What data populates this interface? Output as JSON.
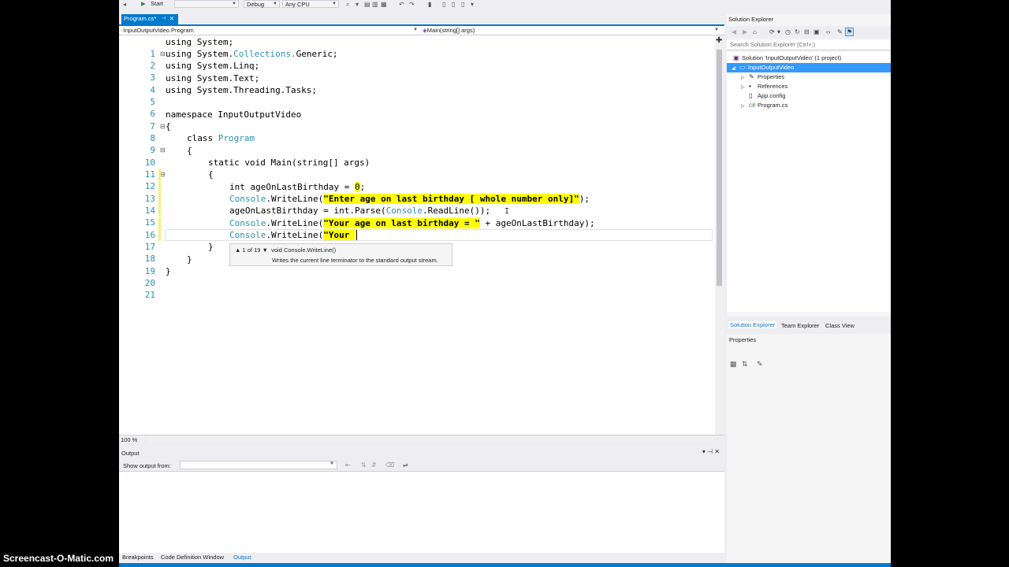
{
  "toolbar": {
    "start_label": "Start",
    "config_value": "Debug",
    "platform_value": "Any CPU"
  },
  "tab": {
    "label": "Program.cs*"
  },
  "navbar": {
    "type_combo": "InputOutputVideo.Program",
    "member_combo": "Main(string[] args)"
  },
  "editor": {
    "line_numbers": [
      "1",
      "2",
      "3",
      "4",
      "5",
      "6",
      "7",
      "8",
      "9",
      "10",
      "11",
      "12",
      "13",
      "14",
      "15",
      "16",
      "17",
      "18",
      "19",
      "20",
      "21"
    ],
    "l1": "using System;",
    "l2_a": "using System.",
    "l2_b": "Collections.",
    "l2_c": "Generic;",
    "l3": "using System.Linq;",
    "l4": "using System.Text;",
    "l5": "using System.Threading.Tasks;",
    "l7": "namespace InputOutputVideo",
    "l8": "{",
    "l9_kw": "class ",
    "l9_ty": "Program",
    "l10": "{",
    "l11": "static void Main(string[] args)",
    "l12": "{",
    "l13_a": "int ageOnLastBirthday = ",
    "l13_num": "0",
    "l13_b": ";",
    "l14_ty": "Console",
    "l14_a": ".WriteLine(",
    "l14_str": "\"Enter age on last birthday [ whole number only]\"",
    "l14_b": ");",
    "l15_a": "ageOnLastBirthday = int.Parse(",
    "l15_ty": "Console",
    "l15_b": ".ReadLine());",
    "l16_ty": "Console",
    "l16_a": ".WriteLine(",
    "l16_str": "\"Your age on last birthday = \"",
    "l16_b": " + ageOnLastBirthday);",
    "l17_ty": "Console",
    "l17_a": ".WriteLine(",
    "l17_str": "\"Your ",
    "l18": "}",
    "l19": "}",
    "l20": "}"
  },
  "tooltip": {
    "counter": "▲ 1 of 19 ▼",
    "signature": "void Console.WriteLine()",
    "description": "Writes the current line terminator to the standard output stream."
  },
  "zoom": {
    "level": "100 %"
  },
  "output": {
    "title": "Output",
    "show_from_label": "Show output from:",
    "show_from_value": ""
  },
  "bottom_tabs": [
    "Breakpoints",
    "Code Definition Window",
    "Output"
  ],
  "solution_explorer": {
    "title": "Solution Explorer",
    "search_placeholder": "Search Solution Explorer (Ctrl+;)",
    "solution": "Solution 'InputOutputVideo' (1 project)",
    "project": "InputOutputVideo",
    "items": [
      "Properties",
      "References",
      "App.config",
      "Program.cs"
    ]
  },
  "se_tabs": [
    "Solution Explorer",
    "Team Explorer",
    "Class View"
  ],
  "properties": {
    "title": "Properties"
  },
  "watermark": "Screencast-O-Matic.com",
  "colors": {
    "accent": "#007acc",
    "highlight": "#ffff00",
    "type": "#2b91af"
  }
}
